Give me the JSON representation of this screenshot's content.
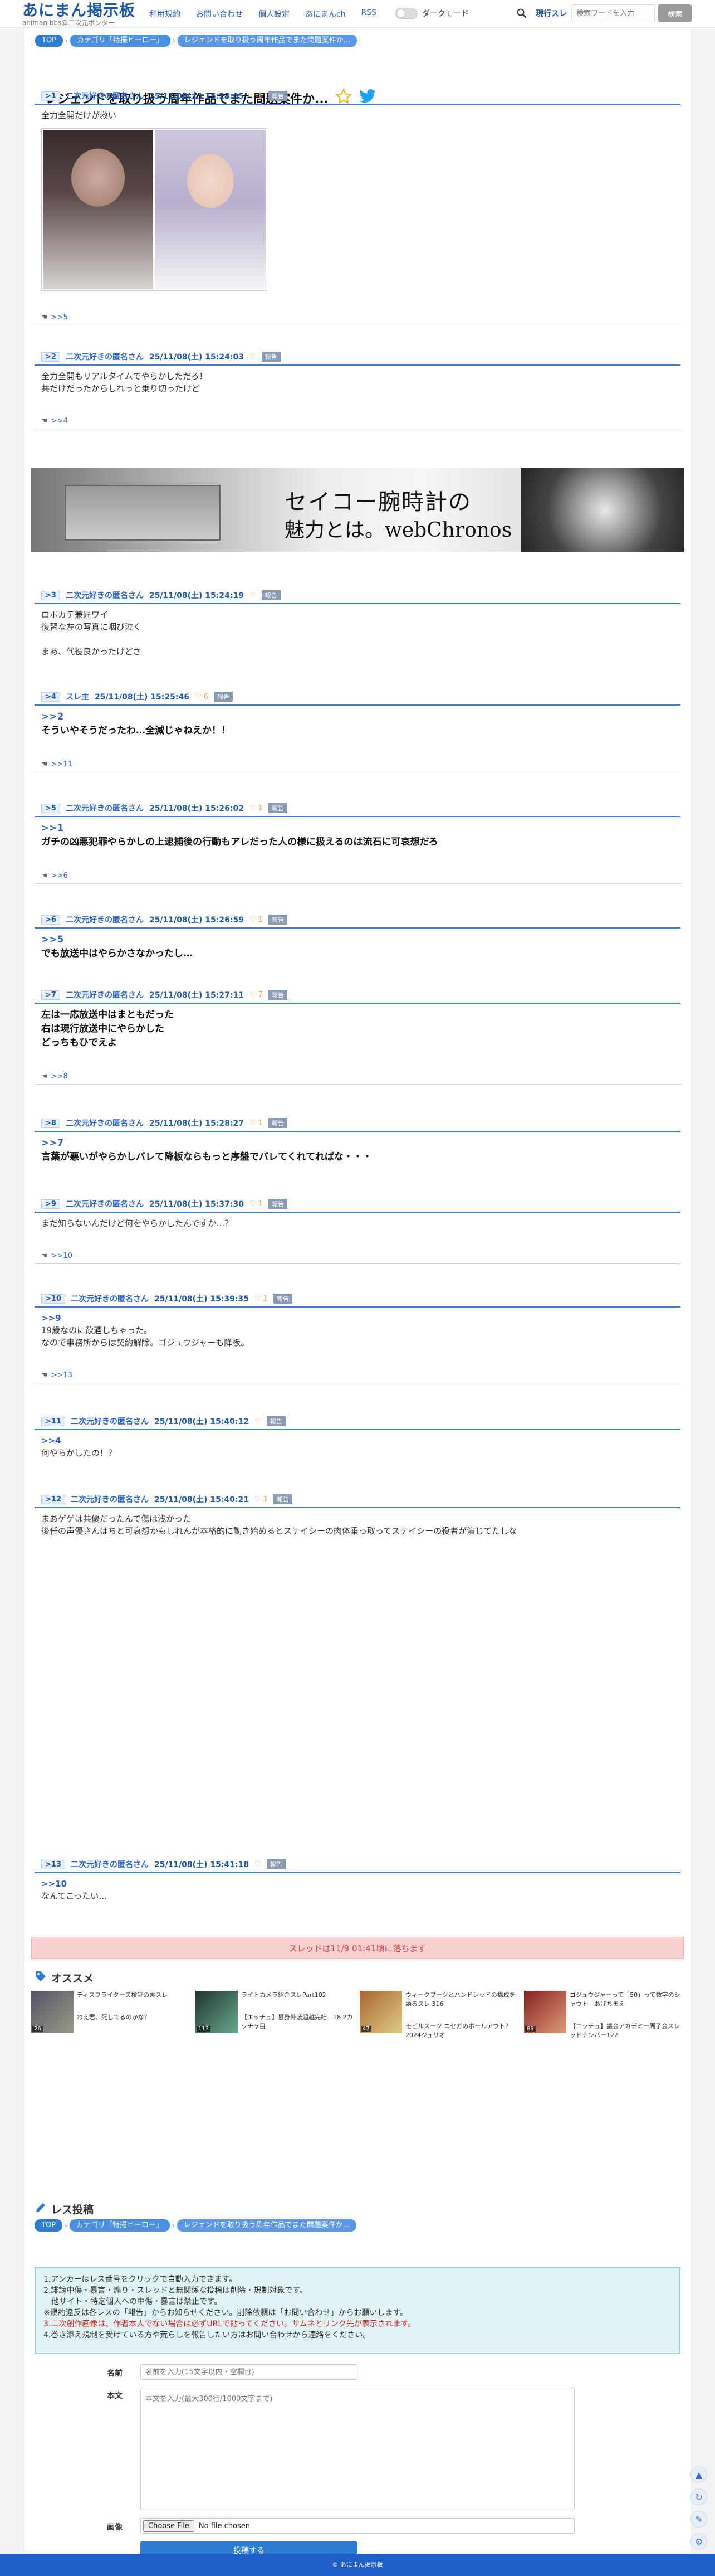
{
  "site": {
    "logo": "あにまん掲示板",
    "logo_sub": "animan bbs@二次元ポンター"
  },
  "nav": [
    "利用規約",
    "お問い合わせ",
    "個人設定",
    "あにまんch",
    "RSS"
  ],
  "dark_mode_label": "ダークモード",
  "search": {
    "scope": "現行スレ",
    "placeholder": "検索ワードを入力",
    "button": "検索"
  },
  "breadcrumb": {
    "top": "TOP",
    "category": "カテゴリ「特撮ヒーロー」",
    "current": "レジェンドを取り扱う周年作品でまた問題案件か..."
  },
  "thread_title": "レジェンドを取り扱う周年作品でまた問題案件か...",
  "posts": [
    {
      "num": ">1",
      "name": "二次元好きの匿名さん",
      "date": "25/11/08(土) 15:23:05",
      "likes": "1",
      "report": "報告",
      "text": "全力全開だけが救い",
      "reply": ">>5"
    },
    {
      "num": ">2",
      "name": "二次元好きの匿名さん",
      "date": "25/11/08(土) 15:24:03",
      "likes": "",
      "report": "報告",
      "text": "全力全開もリアルタイムでやらかしただろ！\n共だけだったからしれっと乗り切ったけど",
      "reply": ">>4"
    },
    {
      "num": ">3",
      "name": "二次元好きの匿名さん",
      "date": "25/11/08(土) 15:24:19",
      "likes": "",
      "report": "報告",
      "text": "ロボカテ兼匠ワイ\n復習な左の写真に咽び泣く\n\nまあ、代役良かったけどさ"
    },
    {
      "num": ">4",
      "name": "スレ主",
      "date": "25/11/08(土) 15:25:46",
      "likes": "6",
      "report": "報告",
      "anchor": ">>2",
      "text": "そういやそうだったわ…全滅じゃねえか！！",
      "reply": ">>11"
    },
    {
      "num": ">5",
      "name": "二次元好きの匿名さん",
      "date": "25/11/08(土) 15:26:02",
      "likes": "1",
      "report": "報告",
      "anchor": ">>1",
      "text": "ガチの凶悪犯罪やらかしの上逮捕後の行動もアレだった人の様に扱えるのは流石に可哀想だろ",
      "reply": ">>6"
    },
    {
      "num": ">6",
      "name": "二次元好きの匿名さん",
      "date": "25/11/08(土) 15:26:59",
      "likes": "1",
      "report": "報告",
      "anchor": ">>5",
      "text": "でも放送中はやらかさなかったし…"
    },
    {
      "num": ">7",
      "name": "二次元好きの匿名さん",
      "date": "25/11/08(土) 15:27:11",
      "likes": "7",
      "report": "報告",
      "text": "左は一応放送中はまともだった\n右は現行放送中にやらかした\nどっちもひでえよ",
      "reply": ">>8"
    },
    {
      "num": ">8",
      "name": "二次元好きの匿名さん",
      "date": "25/11/08(土) 15:28:27",
      "likes": "1",
      "report": "報告",
      "anchor": ">>7",
      "text": "言葉が悪いがやらかしバレて降板ならもっと序盤でバレてくれてればな・・・"
    },
    {
      "num": ">9",
      "name": "二次元好きの匿名さん",
      "date": "25/11/08(土) 15:37:30",
      "likes": "1",
      "report": "報告",
      "text": "まだ知らないんだけど何をやらかしたんですか…？",
      "reply": ">>10"
    },
    {
      "num": ">10",
      "name": "二次元好きの匿名さん",
      "date": "25/11/08(土) 15:39:35",
      "likes": "1",
      "report": "報告",
      "anchor": ">>9",
      "text": "19歳なのに飲酒しちゃった。\nなので事務所からは契約解除。ゴジュウジャーも降板。",
      "reply": ">>13"
    },
    {
      "num": ">11",
      "name": "二次元好きの匿名さん",
      "date": "25/11/08(土) 15:40:12",
      "likes": "",
      "report": "報告",
      "anchor": ">>4",
      "text": "何やらかしたの！？"
    },
    {
      "num": ">12",
      "name": "二次元好きの匿名さん",
      "date": "25/11/08(土) 15:40:21",
      "likes": "1",
      "report": "報告",
      "text": "まあゲゲは共優だったんで傷は浅かった\n後任の声優さんはちと可哀想かもしれんが本格的に動き始めるとステイシーの肉体乗っ取ってステイシーの役者が演じてたしな"
    },
    {
      "num": ">13",
      "name": "二次元好きの匿名さん",
      "date": "25/11/08(土) 15:41:18",
      "likes": "",
      "report": "報告",
      "anchor": ">>10",
      "text": "なんてこったい…"
    }
  ],
  "ad": {
    "line1": "セイコー腕時計の",
    "line2": "魅力とは。webChronos"
  },
  "thread_end": "スレッドは11/9 01:41頃に落ちます",
  "recommend": {
    "title": "オススメ",
    "items": [
      {
        "title": "ディスフライターズ検証の裏スレ",
        "sub": "ねえ君、死してるのかな？",
        "count": "26"
      },
      {
        "title": "ライトカメラ紹介スレPart102",
        "sub": "【エッチュ】篡身外装超越完結　18 2カッチャ目",
        "count": "113"
      },
      {
        "title": "ウィークブーツとハンドレッドの構成を語るスレ 316",
        "sub": "モビルスーツ ニセガのボールアウト？ 2024ジュリオ",
        "count": "47"
      },
      {
        "title": "ゴジュウジャーって「50」って数字のシャウト　あげちまえ",
        "sub": "【エッチュ】議会アカデミー周子会スレッドナンバー122",
        "count": "89"
      }
    ]
  },
  "post_form": {
    "title": "レス投稿",
    "rules": [
      "1.アンカーはレス番号をクリックで自動入力できます。",
      "2.誹謗中傷・暴言・煽り・スレッドと無関係な投稿は削除・規制対象です。",
      "　他サイト・特定個人への中傷・暴言は禁止です。",
      "※規約違反は各レスの「報告」からお知らせください。削除依頼は「お問い合わせ」からお願いします。",
      "3.二次創作画像は、作者本人でない場合は必ずURLで貼ってください。サムネとリンク先が表示されます。",
      "4.巻き添え規制を受けている方や荒らしを報告したい方はお問い合わせから連絡をください。"
    ],
    "name_label": "名前",
    "name_placeholder": "名前を入力(15文字以内・空欄可)",
    "body_label": "本文",
    "body_placeholder": "本文を入力(最大300行/1000文字まで)",
    "image_label": "画像",
    "file_button": "Choose File",
    "file_none": "No file chosen",
    "submit": "投稿する"
  },
  "footer": "© あにまん掲示板",
  "colors": {
    "brand": "#1f5aa8",
    "accent": "#2f7dd1",
    "heart": "#f4a04a",
    "ended_bg": "#f8d0d0",
    "rules_bg": "#e0f4f6"
  }
}
